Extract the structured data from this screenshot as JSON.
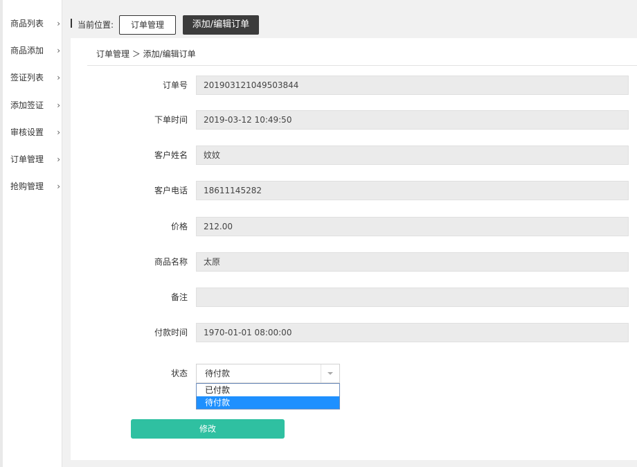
{
  "sidebar": {
    "items": [
      {
        "label": "商品列表"
      },
      {
        "label": "商品添加"
      },
      {
        "label": "签证列表"
      },
      {
        "label": "添加签证"
      },
      {
        "label": "审核设置"
      },
      {
        "label": "订单管理"
      },
      {
        "label": "抢购管理"
      }
    ],
    "chevron": "›"
  },
  "topbar": {
    "location_label": "当前位置:",
    "crumbs": [
      "订单管理",
      "添加/编辑订单"
    ]
  },
  "panel": {
    "breadcrumb": "订单管理 ＞ 添加/编辑订单"
  },
  "form": {
    "fields": [
      {
        "label": "订单号",
        "value": "201903121049503844"
      },
      {
        "label": "下单时间",
        "value": "2019-03-12 10:49:50"
      },
      {
        "label": "客户姓名",
        "value": "妏妏"
      },
      {
        "label": "客户电话",
        "value": "18611145282"
      },
      {
        "label": "价格",
        "value": "212.00"
      },
      {
        "label": "商品名称",
        "value": "太原"
      },
      {
        "label": "备注",
        "value": ""
      },
      {
        "label": "付款时间",
        "value": "1970-01-01 08:00:00"
      }
    ],
    "status": {
      "label": "状态",
      "selected": "待付款",
      "options": [
        "已付款",
        "待付款"
      ]
    },
    "submit_label": "修改"
  },
  "colors": {
    "accent": "#2fc0a1",
    "active_crumb": "#3c3c3c",
    "option_highlight": "#1e90ff"
  }
}
